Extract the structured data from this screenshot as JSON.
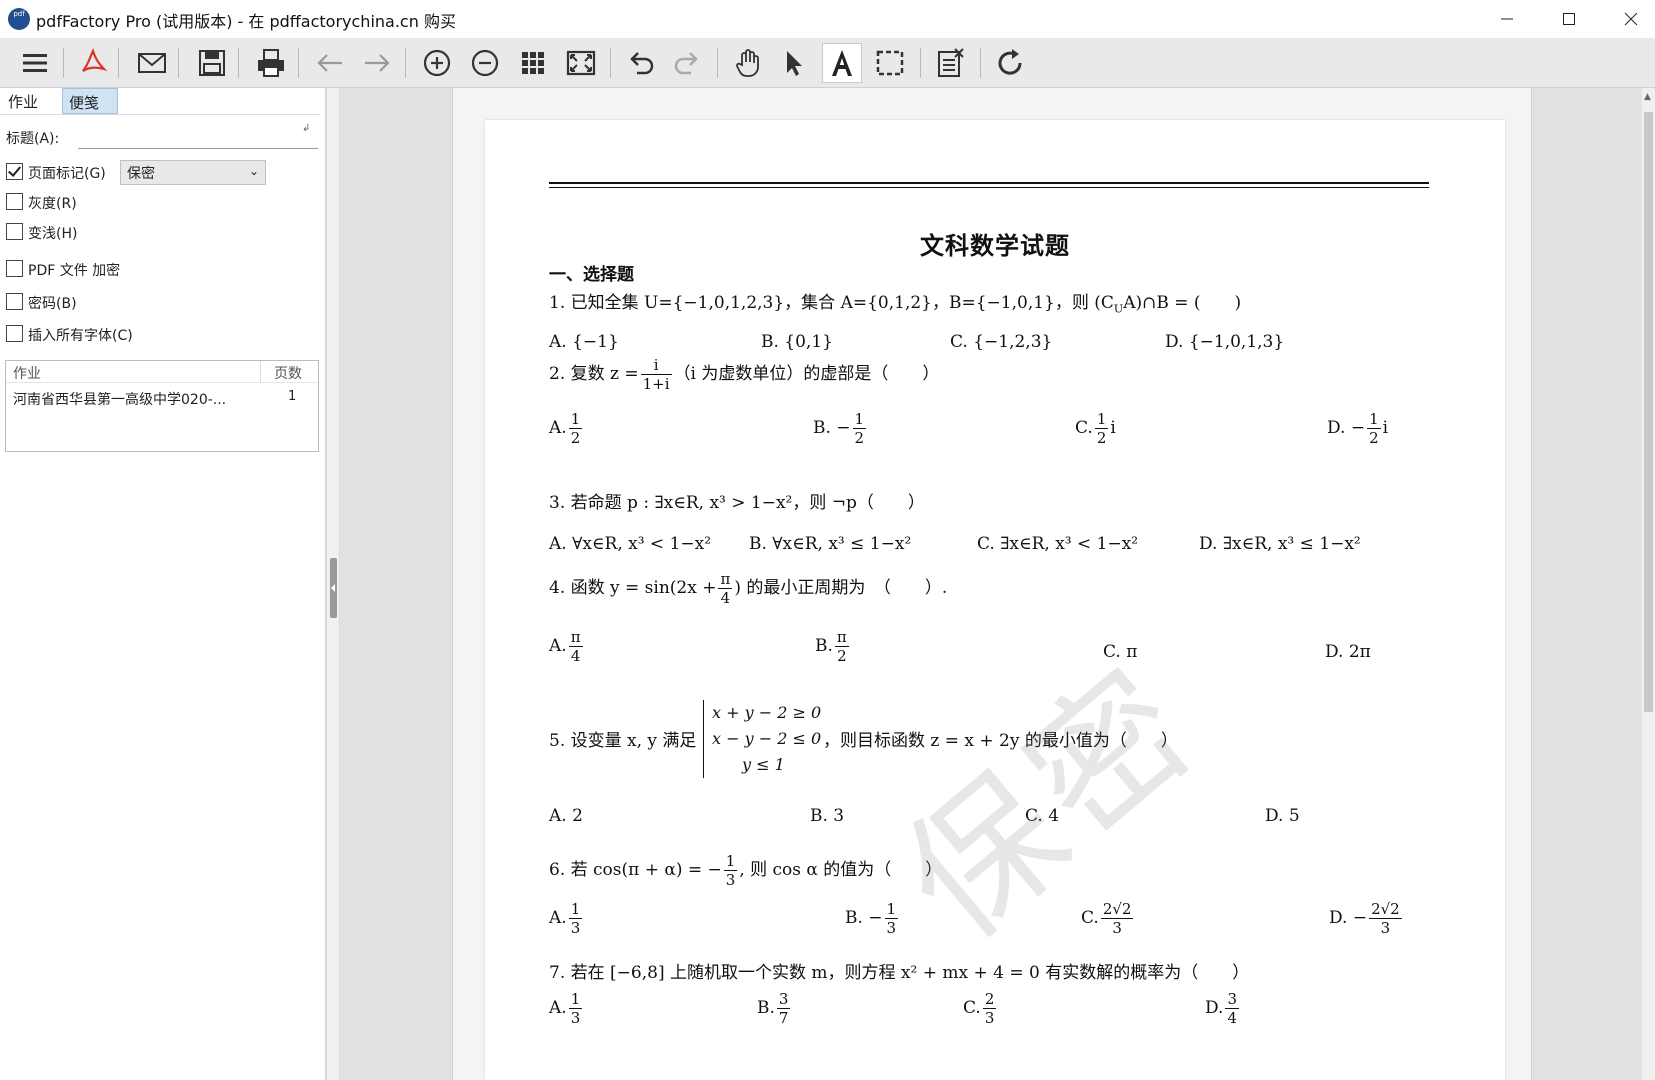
{
  "window": {
    "title": "pdfFactory Pro (试用版本) - 在 pdffactorychina.cn 购买",
    "logo_text": "pdf"
  },
  "toolbar": {
    "icons": [
      "menu-icon",
      "pdf-icon",
      "mail-icon",
      "save-icon",
      "print-icon",
      "back-arrow-icon",
      "forward-arrow-icon",
      "zoom-in-icon",
      "zoom-out-icon",
      "thumbnails-icon",
      "fit-page-icon",
      "undo-icon",
      "redo-icon",
      "hand-tool-icon",
      "select-arrow-icon",
      "text-tool-icon",
      "marquee-select-icon",
      "delete-page-icon",
      "refresh-icon"
    ],
    "accent": "#d9342b"
  },
  "panel": {
    "tabs": [
      "作业",
      "便笺"
    ],
    "title_label": "标题(A):",
    "title_value": "",
    "page_mark_label": "页面标记(G)",
    "page_mark_value": "保密",
    "grayscale_label": "灰度(R)",
    "lighten_label": "变浅(H)",
    "pdf_encrypt_label": "PDF 文件 加密",
    "password_label": "密码(B)",
    "embed_fonts_label": "插入所有字体(C)",
    "job_header": "作业",
    "pages_header": "页数",
    "jobs": [
      {
        "name": "河南省西华县第一高级中学020-...",
        "pages": "1"
      }
    ]
  },
  "doc": {
    "title": "文科数学试题",
    "section": "一、选择题",
    "watermark": "保密",
    "q1": "1. 已知全集 U={−1,0,1,2,3}，集合 A={0,1,2}，B={−1,0,1}，则 (C",
    "q1_sub": "U",
    "q1_tail": "A)∩B = (　　)",
    "q1_opts": [
      "A. {−1}",
      "B. {0,1}",
      "C. {−1,2,3}",
      "D. {−1,0,1,3}"
    ],
    "q2_head": "2. 复数 z =",
    "q2_num": "i",
    "q2_den": "1+i",
    "q2_tail": "（i 为虚数单位）的虚部是（　　）",
    "q2_opts": [
      {
        "prefix": "A.",
        "num": "1",
        "den": "2",
        "suffix": ""
      },
      {
        "prefix": "B. −",
        "num": "1",
        "den": "2",
        "suffix": ""
      },
      {
        "prefix": "C.",
        "num": "1",
        "den": "2",
        "suffix": "i"
      },
      {
        "prefix": "D. −",
        "num": "1",
        "den": "2",
        "suffix": "i"
      }
    ],
    "q3": "3. 若命题 p : ∃x∈R, x³ > 1−x²，则 ¬p（　　）",
    "q3_opts": [
      "A. ∀x∈R, x³ < 1−x²",
      "B. ∀x∈R, x³ ≤ 1−x²",
      "C. ∃x∈R, x³ < 1−x²",
      "D. ∃x∈R, x³ ≤ 1−x²"
    ],
    "q4_head": "4. 函数 y = sin(2x +",
    "q4_num": "π",
    "q4_den": "4",
    "q4_tail": ") 的最小正周期为　（　　）.",
    "q4_opts": [
      {
        "prefix": "A.",
        "num": "π",
        "den": "4"
      },
      {
        "prefix": "B.",
        "num": "π",
        "den": "2"
      }
    ],
    "q4_opt_c": "C. π",
    "q4_opt_d": "D. 2π",
    "q5_head": "5. 设变量 x, y 满足",
    "q5_sys": [
      "x + y − 2 ≥ 0",
      "x − y − 2 ≤ 0",
      "y ≤ 1"
    ],
    "q5_tail": "，则目标函数 z = x + 2y 的最小值为（　　）",
    "q5_opts": [
      "A. 2",
      "B. 3",
      "C. 4",
      "D. 5"
    ],
    "q6_head": "6. 若 cos(π + α) = −",
    "q6_num": "1",
    "q6_den": "3",
    "q6_tail": ", 则 cos α 的值为（　　）",
    "q6_opts": [
      {
        "prefix": "A.",
        "num": "1",
        "den": "3"
      },
      {
        "prefix": "B. −",
        "num": "1",
        "den": "3"
      },
      {
        "prefix": "C.",
        "num": "2√2",
        "den": "3"
      },
      {
        "prefix": "D. −",
        "num": "2√2",
        "den": "3"
      }
    ],
    "q7": "7. 若在 [−6,8] 上随机取一个实数 m，则方程 x² + mx + 4 = 0 有实数解的概率为（　　）",
    "q7_opts": [
      {
        "prefix": "A.",
        "num": "1",
        "den": "3"
      },
      {
        "prefix": "B.",
        "num": "3",
        "den": "7"
      },
      {
        "prefix": "C.",
        "num": "2",
        "den": "3"
      },
      {
        "prefix": "D.",
        "num": "3",
        "den": "4"
      }
    ]
  }
}
